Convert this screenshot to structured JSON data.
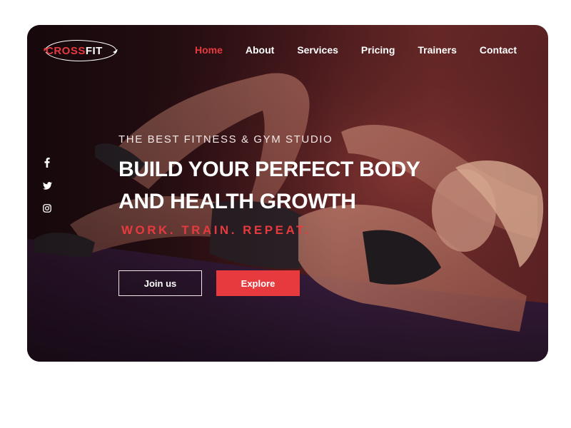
{
  "brand": {
    "part1": "CROSS",
    "part2": "FIT"
  },
  "nav": [
    {
      "label": "Home",
      "active": true
    },
    {
      "label": "About",
      "active": false
    },
    {
      "label": "Services",
      "active": false
    },
    {
      "label": "Pricing",
      "active": false
    },
    {
      "label": "Trainers",
      "active": false
    },
    {
      "label": "Contact",
      "active": false
    }
  ],
  "social": [
    "facebook-icon",
    "twitter-icon",
    "instagram-icon"
  ],
  "hero": {
    "eyebrow": "THE BEST FITNESS & GYM STUDIO",
    "headline_line1": "BUILD YOUR PERFECT BODY",
    "headline_line2": "AND HEALTH GROWTH",
    "tagline": "WORK. TRAIN. REPEAT."
  },
  "buttons": {
    "join": "Join us",
    "explore": "Explore"
  },
  "colors": {
    "accent": "#e63a3f",
    "text": "#ffffff"
  }
}
